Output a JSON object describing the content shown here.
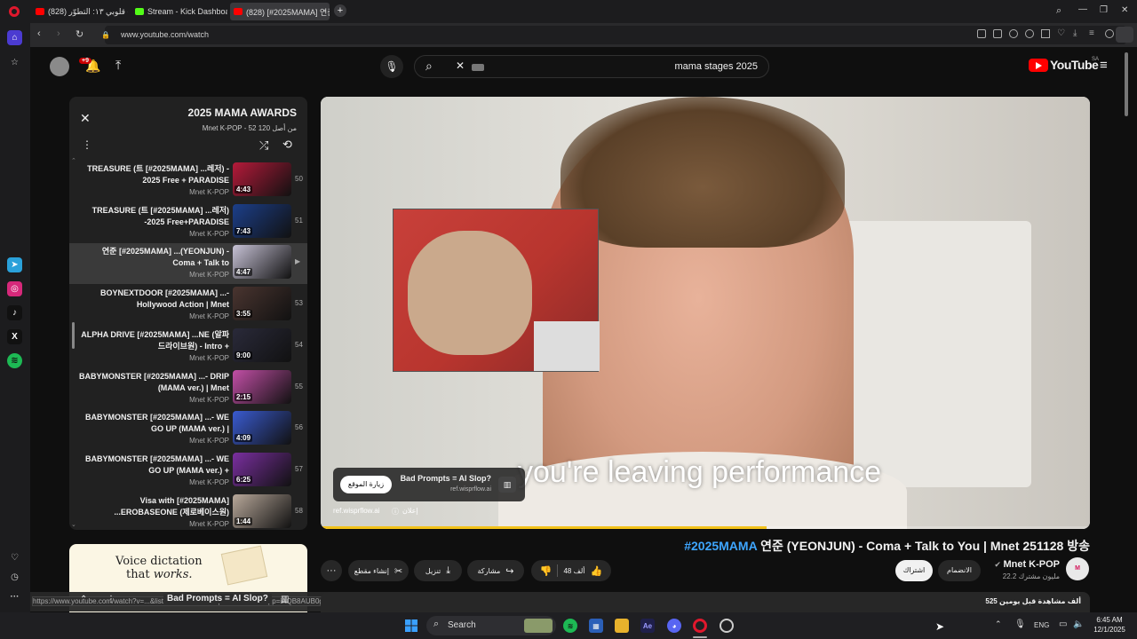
{
  "browser": {
    "tabs": [
      {
        "label": "(828) قلوبي ١٣: التطوّر - ...",
        "color": "#ff0000"
      },
      {
        "label": "Stream - Kick Dashboard",
        "color": "#53fc18"
      },
      {
        "label": "(828) [#2025MAMA] 연준",
        "color": "#ff0000"
      }
    ],
    "new_tab": "+",
    "url": "www.youtube.com/watch",
    "window_controls": {
      "minimize": "—",
      "maximize": "❐",
      "close": "✕"
    }
  },
  "youtube": {
    "logo_text": "YouTube",
    "region": "SA",
    "notif_count": "+9",
    "search_query": "mama stages 2025",
    "playlist": {
      "title": "2025 MAMA AWARDS",
      "subtitle": "Mnet K-POP - 52 من أصل 120",
      "items": [
        {
          "title": "TREASURE (트 [#2025MAMA] ...레저) - 2025 Free + PARADISE",
          "channel": "Mnet K-POP",
          "duration": "4:43",
          "num": "50",
          "thumb": "#b51a3a"
        },
        {
          "title": "TREASURE (트 [#2025MAMA] ...레저) -2025 Free+PARADISE",
          "channel": "Mnet K-POP",
          "duration": "7:43",
          "num": "51",
          "thumb": "#1c3f8a"
        },
        {
          "title": "연준 [#2025MAMA] ...(YEONJUN) - Coma + Talk to",
          "channel": "Mnet K-POP",
          "duration": "4:47",
          "num": "▶",
          "thumb": "#c7c2d6"
        },
        {
          "title": "BOYNEXTDOOR [#2025MAMA] ...- Hollywood Action | Mnet",
          "channel": "Mnet K-POP",
          "duration": "3:55",
          "num": "53",
          "thumb": "#4a3530"
        },
        {
          "title": "ALPHA DRIVE [#2025MAMA] ...NE (알파드라이브원) - Intro +",
          "channel": "Mnet K-POP",
          "duration": "9:00",
          "num": "54",
          "thumb": "#2a2a3a"
        },
        {
          "title": "BABYMONSTER [#2025MAMA] ...- DRIP (MAMA ver.) | Mnet",
          "channel": "Mnet K-POP",
          "duration": "2:15",
          "num": "55",
          "thumb": "#c24fa6"
        },
        {
          "title": "BABYMONSTER [#2025MAMA] ...- WE GO UP (MAMA ver.) |",
          "channel": "Mnet K-POP",
          "duration": "4:09",
          "num": "56",
          "thumb": "#3a5bd1"
        },
        {
          "title": "BABYMONSTER [#2025MAMA] ...- WE GO UP (MAMA ver.) +",
          "channel": "Mnet K-POP",
          "duration": "6:25",
          "num": "57",
          "thumb": "#7a2fa0"
        },
        {
          "title": "Visa with [#2025MAMA] ...EROBASEONE (제로베이스원)",
          "channel": "Mnet K-POP",
          "duration": "1:44",
          "num": "58",
          "thumb": "#b8a89a"
        }
      ]
    },
    "ad_banner": {
      "line1": "Voice dictation",
      "line2": "that ",
      "line2b": "works."
    },
    "player": {
      "caption": "you're leaving performance",
      "ad_title": "Bad Prompts = AI Slop?",
      "ad_domain": "ref.wisprflow.ai",
      "ad_button": "زيارة الموقع",
      "ad_footer_domain": "ref.wisprflow.ai",
      "ad_label": "إعلان",
      "progress": 0.58
    },
    "video": {
      "title_hashtag": "#2025MAMA",
      "title_rest": " 연준 (YEONJUN) - Coma + Talk to You | Mnet 251128 방송",
      "channel": "Mnet K-POP",
      "subscribers": "22.2 مليون مشترك",
      "join": "الانضمام",
      "subscribe": "اشتراك",
      "likes": "48 ألف",
      "share": "مشاركة",
      "download": "تنزيل",
      "clip": "إنشاء مقطع",
      "views": "525 ألف مشاهدة قبل يومين",
      "mini_ad_title": "Bad Prompts = AI Slop?"
    },
    "status_url": "https://www.youtube.com/watch?v=...&list=...2K2zY27XS5qM4&index=56&pp=iAQB8AUB0gcJCRUKAYcqIYzv"
  },
  "taskbar": {
    "search_label": "Search",
    "lang": "ENG",
    "time": "6:45 AM",
    "date": "12/1/2025"
  }
}
